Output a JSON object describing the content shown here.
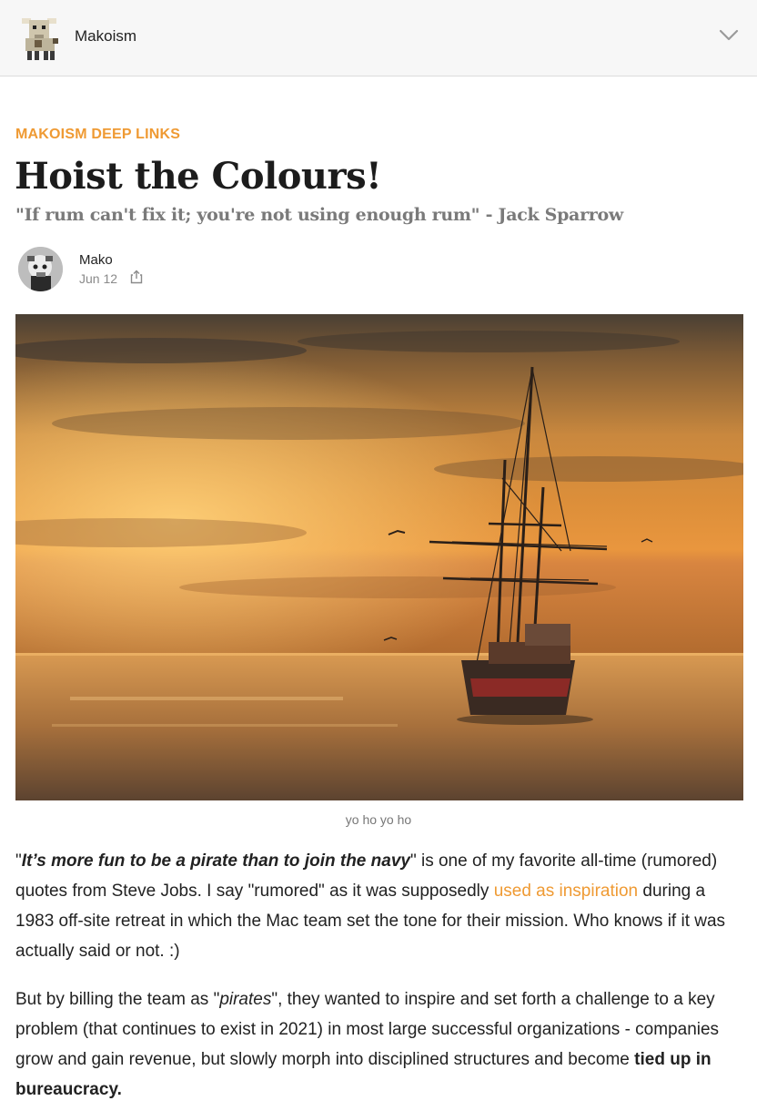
{
  "header": {
    "site_name": "Makoism",
    "logo_icon": "goat-logo-icon",
    "menu_icon": "chevron-down-icon"
  },
  "post": {
    "section": "MAKOISM DEEP LINKS",
    "title": "Hoist the Colours!",
    "subtitle": "\"If rum can't fix it; you're not using enough rum\" - Jack Sparrow",
    "author": "Mako",
    "date": "Jun 12",
    "share_icon": "share-icon",
    "image_caption": "yo ho yo ho"
  },
  "body": {
    "p1": {
      "open_quote": "\"",
      "quote": "It’s more fun to be a pirate than to join the navy",
      "after_quote": "\" is one of my favorite all-time (rumored) quotes from Steve Jobs. I say \"rumored\" as it was supposedly ",
      "link": "used as inspiration",
      "after_link": " during a 1983 off-site retreat in which the Mac team set the tone for their mission. Who knows if it was actually said or not. :)"
    },
    "p2": {
      "before": "But by billing the team as \"",
      "em": "pirates",
      "middle": "\", they wanted to inspire and set forth a challenge to a key problem (that continues to exist in 2021) in most large successful organizations - companies grow and gain revenue, but slowly morph into disciplined structures and become ",
      "bold": "tied up in bureaucracy."
    }
  },
  "colors": {
    "accent": "#ef9a33",
    "title": "#1c1c1c",
    "subtitle": "#7a7a7a"
  }
}
